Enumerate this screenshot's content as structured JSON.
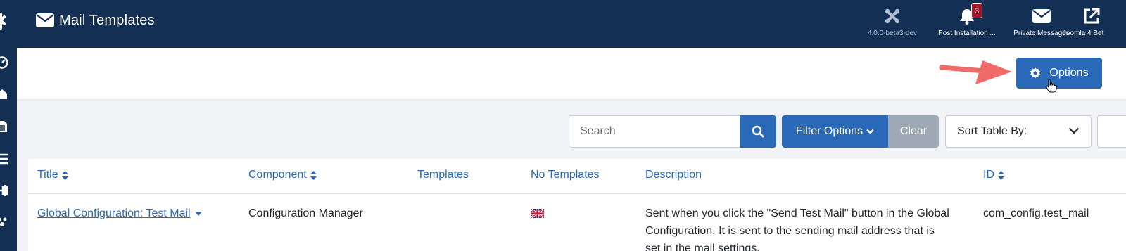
{
  "header": {
    "title": "Mail Templates",
    "title_icon": "envelope-icon",
    "items": [
      {
        "label": "4.0.0-beta3-dev",
        "icon": "joomla-icon"
      },
      {
        "label": "Post Installation ...",
        "icon": "bell-icon",
        "badge": "3"
      },
      {
        "label": "Private Messages",
        "icon": "envelope-icon"
      },
      {
        "label": "Joomla 4 Bet",
        "icon": "external-link-icon"
      }
    ]
  },
  "sidebar": {
    "icons": [
      "dashboard-icon",
      "puzzle-icon",
      "file-icon",
      "list-icon",
      "plug-icon",
      "users-icon"
    ]
  },
  "toolbar": {
    "options_label": "Options"
  },
  "filters": {
    "search_placeholder": "Search",
    "filter_options_label": "Filter Options",
    "clear_label": "Clear",
    "sort_label": "Sort Table By:"
  },
  "table": {
    "columns": [
      "Title",
      "Component",
      "Templates",
      "No Templates",
      "Description",
      "ID"
    ],
    "rows": [
      {
        "title": "Global Configuration: Test Mail",
        "component": "Configuration Manager",
        "templates": "",
        "no_templates_flag": "uk-flag",
        "description_lines": [
          "Sent when you click the \"Send Test Mail\" button in the Global",
          "Configuration. It is sent to the sending mail address that is",
          "set in the mail settings."
        ],
        "id": "com_config.test_mail"
      }
    ]
  },
  "colors": {
    "header_bg": "#132f53",
    "primary": "#2a69b8",
    "clear_bg": "#9fa9b6",
    "badge": "#a5162a",
    "arrow": "#f06a6a"
  }
}
